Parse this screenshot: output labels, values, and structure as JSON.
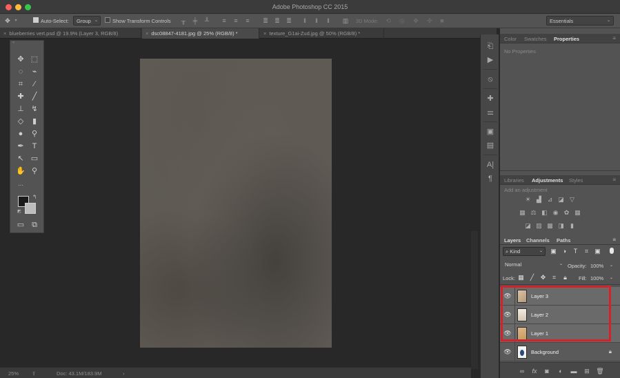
{
  "window": {
    "title": "Adobe Photoshop CC 2015"
  },
  "options_bar": {
    "auto_select_label": "Auto-Select:",
    "auto_select_value": "Group",
    "show_transform_label": "Show Transform Controls",
    "mode_3d_label": "3D Mode:",
    "workspace": "Essentials"
  },
  "tabs": [
    {
      "label": "blueberries vert.psd @ 19.9% (Layer 3, RGB/8)"
    },
    {
      "label": "dsc08847-4181.jpg @ 25% (RGB/8) *"
    },
    {
      "label": "texture_G1ai-Zud.jpg @ 50% (RGB/8) *"
    }
  ],
  "status": {
    "zoom": "25%",
    "doc": "Doc: 43.1M/183.9M"
  },
  "panels": {
    "top": {
      "tabs": [
        "Color",
        "Swatches",
        "Properties"
      ],
      "active": "Properties",
      "content": "No Properties"
    },
    "middle": {
      "tabs": [
        "Libraries",
        "Adjustments",
        "Styles"
      ],
      "active": "Adjustments",
      "hint": "Add an adjustment"
    },
    "layers": {
      "tabs": [
        "Layers",
        "Channels",
        "Paths"
      ],
      "active": "Layers",
      "filter": "Kind",
      "blend_mode": "Normal",
      "opacity_label": "Opacity:",
      "opacity": "100%",
      "lock_label": "Lock:",
      "fill_label": "Fill:",
      "fill": "100%",
      "items": [
        {
          "name": "Layer 3",
          "selected": true,
          "locked": false
        },
        {
          "name": "Layer 2",
          "selected": true,
          "locked": false
        },
        {
          "name": "Layer 1",
          "selected": true,
          "locked": false
        },
        {
          "name": "Background",
          "selected": false,
          "locked": true
        }
      ]
    }
  },
  "colors": {
    "highlight": "#d2232a",
    "close": "#fc605c",
    "minimize": "#fdbc40",
    "zoom": "#34c749"
  },
  "icons": {
    "eye": "eye-icon",
    "lock": "lock-icon",
    "move": "move-icon",
    "marquee": "marquee-icon",
    "lasso": "lasso-icon",
    "crop": "crop-icon"
  }
}
